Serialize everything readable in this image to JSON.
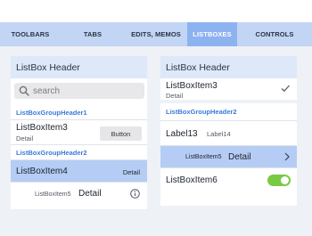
{
  "tabs": [
    {
      "label": "TOOLBARS",
      "active": false
    },
    {
      "label": "TABS",
      "active": false
    },
    {
      "label": "EDITS, MEMOS",
      "active": false
    },
    {
      "label": "LISTBOXES",
      "active": true
    },
    {
      "label": "CONTROLS",
      "active": false
    }
  ],
  "left_panel": {
    "header": "ListBox Header",
    "search_placeholder": "search",
    "group1": "ListBoxGroupHeader1",
    "item3": {
      "title": "ListBoxItem3",
      "subtitle": "Detail",
      "button": "Button"
    },
    "group2": "ListBoxGroupHeader2",
    "item4": {
      "title": "ListBoxItem4",
      "detail": "Detail"
    },
    "item5": {
      "title": "ListBoxItem5",
      "detail": "Detail"
    }
  },
  "right_panel": {
    "header": "ListBox Header",
    "item3": {
      "title": "ListBoxItem3",
      "subtitle": "Detail"
    },
    "group2": "ListBoxGroupHeader2",
    "label13": {
      "title": "Label13",
      "sub": "Label14"
    },
    "item5": {
      "title": "ListBoxItem5",
      "detail": "Detail"
    },
    "item6": {
      "title": "ListBoxItem6",
      "toggle_on": true
    }
  },
  "colors": {
    "tab_bar": "#c2d5f4",
    "tab_active": "#8db2f0",
    "group_header_text": "#3a7ad8",
    "selected_item": "#b5cdf4",
    "toggle_on": "#7ac943"
  }
}
